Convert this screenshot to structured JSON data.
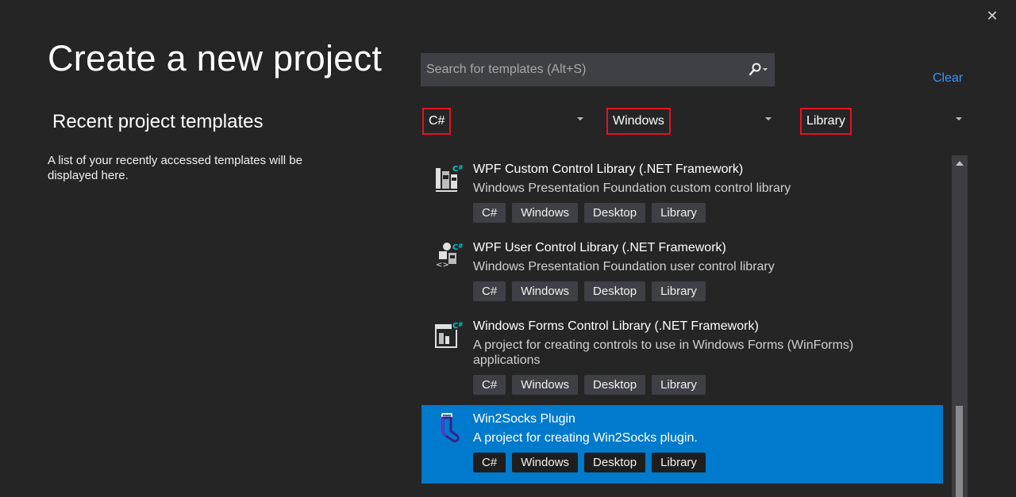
{
  "dialog": {
    "title": "Create a new project",
    "close_glyph": "✕"
  },
  "recent": {
    "title": "Recent project templates",
    "description": "A list of your recently accessed templates will be displayed here."
  },
  "search": {
    "placeholder": "Search for templates (Alt+S)",
    "value": "",
    "icon": "search-icon"
  },
  "clear_label": "Clear",
  "filters": {
    "language": "C#",
    "platform": "Windows",
    "project_type": "Library"
  },
  "templates": [
    {
      "name": "WPF Custom Control Library (.NET Framework)",
      "description": "Windows Presentation Foundation custom control library",
      "tags": [
        "C#",
        "Windows",
        "Desktop",
        "Library"
      ],
      "selected": false
    },
    {
      "name": "WPF User Control Library (.NET Framework)",
      "description": "Windows Presentation Foundation user control library",
      "tags": [
        "C#",
        "Windows",
        "Desktop",
        "Library"
      ],
      "selected": false
    },
    {
      "name": "Windows Forms Control Library (.NET Framework)",
      "description": "A project for creating controls to use in Windows Forms (WinForms) applications",
      "tags": [
        "C#",
        "Windows",
        "Desktop",
        "Library"
      ],
      "selected": false
    },
    {
      "name": "Win2Socks Plugin",
      "description": "A project for creating Win2Socks plugin.",
      "tags": [
        "C#",
        "Windows",
        "Desktop",
        "Library"
      ],
      "selected": true
    }
  ],
  "colors": {
    "background": "#252526",
    "selection": "#007acc",
    "link": "#3794ff",
    "highlight_border": "#e81123",
    "csharp_badge": "#68217a"
  }
}
